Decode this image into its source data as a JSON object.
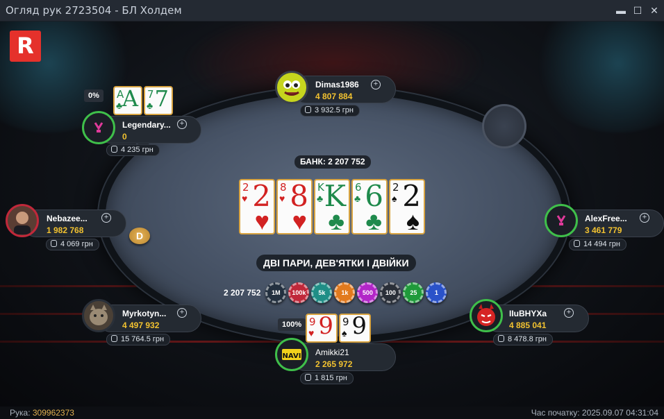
{
  "window": {
    "title": "Огляд рук 2723504 - БЛ Холдем",
    "minimize": "▬",
    "maximize": "☐",
    "close": "✕"
  },
  "brand": {
    "logo_letter": "R",
    "logo_color": "#e5312b"
  },
  "pot": {
    "label": "БАНК: 2 207 752"
  },
  "board": [
    {
      "rank": "2",
      "suit": "♥",
      "color": "red"
    },
    {
      "rank": "8",
      "suit": "♥",
      "color": "red"
    },
    {
      "rank": "K",
      "suit": "♣",
      "color": "green"
    },
    {
      "rank": "6",
      "suit": "♣",
      "color": "green"
    },
    {
      "rank": "2",
      "suit": "♠",
      "color": "black"
    }
  ],
  "hand_result": "ДВІ ПАРИ, ДЕВ'ЯТКИ І ДВІЙКИ",
  "chips": {
    "total": "2 207 752",
    "stack": [
      {
        "label": "1M",
        "color": "#23303f"
      },
      {
        "label": "100k",
        "color": "#c0283a"
      },
      {
        "label": "5k",
        "color": "#1f8e86"
      },
      {
        "label": "1k",
        "color": "#e27a1e"
      },
      {
        "label": "500",
        "color": "#b226c8"
      },
      {
        "label": "100",
        "color": "#2a2f38"
      },
      {
        "label": "25",
        "color": "#1f9a3a"
      },
      {
        "label": "1",
        "color": "#2a52c9"
      }
    ]
  },
  "dealer_button": "D",
  "players": {
    "dimas": {
      "name": "Dimas1986",
      "stack": "4 807 884",
      "win": "3 932.5 грн",
      "avatar_icon": "monster-face"
    },
    "legendary": {
      "name": "Legendary...",
      "stack": "0",
      "win": "4 235 грн",
      "equity": "0%",
      "cards": [
        {
          "rank": "A",
          "suit": "♣"
        },
        {
          "rank": "7",
          "suit": "♣"
        }
      ],
      "avatar_icon": "vbet-logo"
    },
    "nebazee": {
      "name": "Nebazee...",
      "stack": "1 982 768",
      "win": "4 069 грн",
      "avatar_icon": "person-photo"
    },
    "alexfree": {
      "name": "AlexFree...",
      "stack": "3 461 779",
      "win": "14 494 грн",
      "avatar_icon": "vbet-logo"
    },
    "myrkotyn": {
      "name": "Myrkotyn...",
      "stack": "4 497 932",
      "win": "15 764.5 грн",
      "avatar_icon": "cat-photo"
    },
    "iubhyxa": {
      "name": "IIuBHYXa",
      "stack": "4 885 041",
      "win": "8 478.8 грн",
      "avatar_icon": "devil-face"
    },
    "amikki": {
      "name": "Amikki21",
      "stack": "2 265 972",
      "win": "1 815 грн",
      "equity": "100%",
      "cards": [
        {
          "rank": "9",
          "suit": "♥",
          "color": "red"
        },
        {
          "rank": "9",
          "suit": "♠",
          "color": "black"
        }
      ],
      "avatar_icon": "navi-logo"
    }
  },
  "status": {
    "hand_label": "Рука:",
    "hand_id": "309962373",
    "time_label": "Час початку:",
    "time_value": "2025.09.07 04:31:04"
  }
}
